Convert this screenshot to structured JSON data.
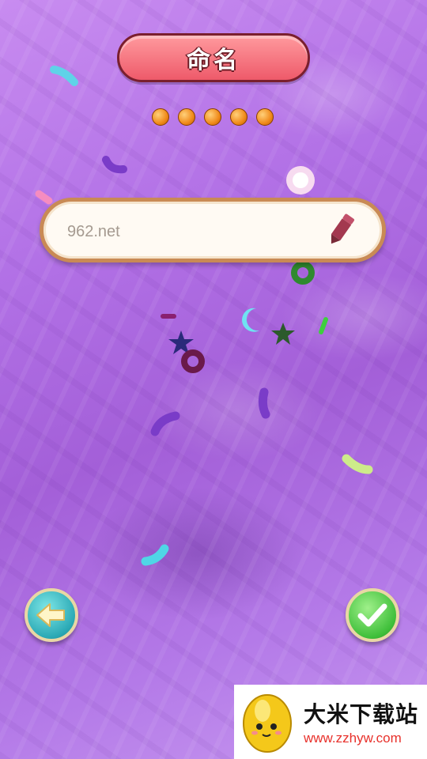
{
  "header": {
    "title": "命名"
  },
  "progress": {
    "total_dots": 5
  },
  "name_field": {
    "value": "962.net",
    "edit_icon": "pencil-icon"
  },
  "buttons": {
    "back_icon": "arrow-left-icon",
    "confirm_icon": "checkmark-icon"
  },
  "watermark": {
    "site_name": "大米下载站",
    "url": "www.zzhyw.com"
  },
  "colors": {
    "background": "#b271e6",
    "title_pill": "#ee5a6a",
    "dot": "#f08a1a",
    "back": "#2aa9b5",
    "confirm": "#3fbf3a"
  }
}
